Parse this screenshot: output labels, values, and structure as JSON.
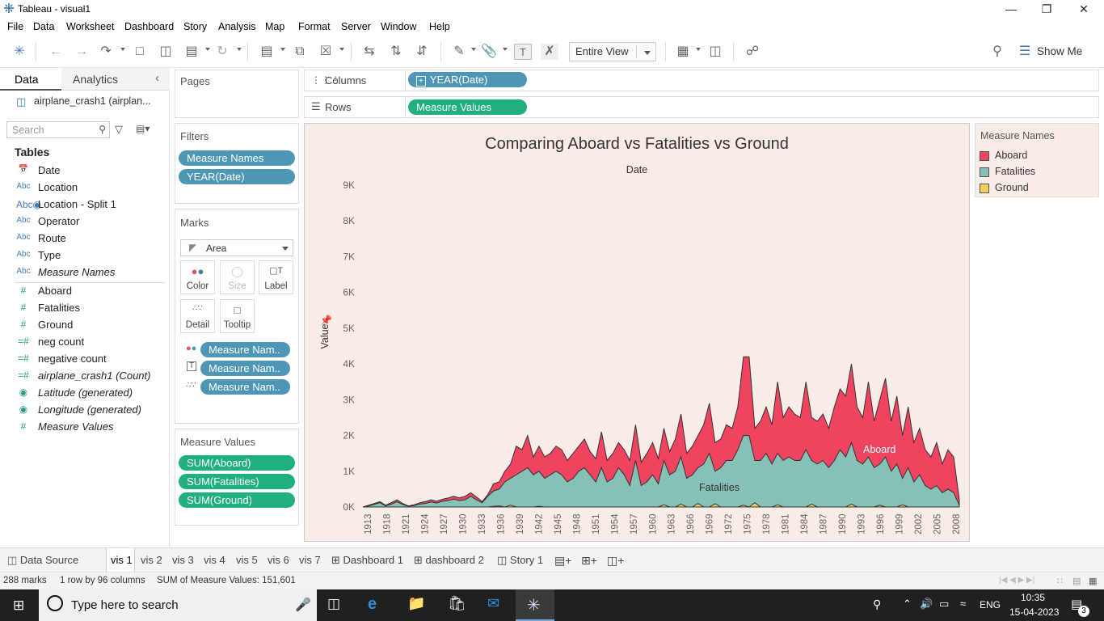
{
  "window": {
    "title": "Tableau - visual1"
  },
  "menu": [
    "File",
    "Data",
    "Worksheet",
    "Dashboard",
    "Story",
    "Analysis",
    "Map",
    "Format",
    "Server",
    "Window",
    "Help"
  ],
  "toolbar": {
    "fit": "Entire View",
    "show_me": "Show Me"
  },
  "datapane": {
    "tab_data": "Data",
    "tab_analytics": "Analytics",
    "datasource": "airplane_crash1 (airplan...",
    "search_placeholder": "Search",
    "tables_heading": "Tables",
    "dimensions": [
      {
        "type": "date",
        "name": "Date"
      },
      {
        "type": "Abc",
        "name": "Location"
      },
      {
        "type": "geo",
        "name": "Location - Split 1"
      },
      {
        "type": "Abc",
        "name": "Operator"
      },
      {
        "type": "Abc",
        "name": "Route"
      },
      {
        "type": "Abc",
        "name": "Type"
      },
      {
        "type": "Abc",
        "name": "Measure Names"
      }
    ],
    "measures": [
      {
        "type": "#",
        "name": "Aboard"
      },
      {
        "type": "#",
        "name": "Fatalities"
      },
      {
        "type": "#",
        "name": "Ground"
      },
      {
        "type": "=#",
        "name": "neg count"
      },
      {
        "type": "=#",
        "name": "negative count"
      },
      {
        "type": "=#",
        "name": "airplane_crash1 (Count)"
      },
      {
        "type": "geo",
        "name": "Latitude (generated)"
      },
      {
        "type": "geo",
        "name": "Longitude (generated)"
      },
      {
        "type": "#",
        "name": "Measure Values"
      }
    ]
  },
  "shelves": {
    "pages": "Pages",
    "filters": "Filters",
    "filter_pills": [
      "Measure Names",
      "YEAR(Date)"
    ],
    "marks": "Marks",
    "mark_type": "Area",
    "mark_buttons": [
      "Color",
      "Size",
      "Label",
      "Detail",
      "Tooltip"
    ],
    "mark_pills": [
      "Measure Nam..",
      "Measure Nam..",
      "Measure Nam.."
    ],
    "measure_values": "Measure Values",
    "measure_value_pills": [
      "SUM(Aboard)",
      "SUM(Fatalities)",
      "SUM(Ground)"
    ],
    "columns_label": "Columns",
    "columns_pill": "YEAR(Date)",
    "rows_label": "Rows",
    "rows_pill": "Measure Values"
  },
  "legend": {
    "title": "Measure Names",
    "items": [
      {
        "name": "Aboard",
        "color": "#f0435f"
      },
      {
        "name": "Fatalities",
        "color": "#86c1b5"
      },
      {
        "name": "Ground",
        "color": "#f4cd5c"
      }
    ]
  },
  "chart_data": {
    "type": "area",
    "title": "Comparing Aboard vs Fatalities vs Ground",
    "xlabel": "Date",
    "ylabel": "Value",
    "ylim": [
      0,
      9000
    ],
    "yticks": [
      "9K",
      "8K",
      "7K",
      "6K",
      "5K",
      "4K",
      "3K",
      "2K",
      "1K",
      "0K"
    ],
    "xtick_labels": [
      "1913",
      "1918",
      "1921",
      "1924",
      "1927",
      "1930",
      "1933",
      "1936",
      "1939",
      "1942",
      "1945",
      "1948",
      "1951",
      "1954",
      "1957",
      "1960",
      "1963",
      "1966",
      "1969",
      "1972",
      "1975",
      "1978",
      "1981",
      "1984",
      "1987",
      "1990",
      "1993",
      "1996",
      "1999",
      "2002",
      "2005",
      "2008"
    ],
    "annotations": [
      "Aboard",
      "Fatalities"
    ],
    "series": [
      {
        "name": "Aboard",
        "values": [
          0,
          50,
          100,
          150,
          50,
          120,
          200,
          100,
          30,
          60,
          120,
          150,
          200,
          160,
          220,
          250,
          300,
          250,
          300,
          400,
          280,
          150,
          350,
          650,
          700,
          1000,
          1200,
          1700,
          1600,
          2000,
          1400,
          1700,
          1400,
          1500,
          1700,
          1600,
          1300,
          1500,
          1700,
          1900,
          1550,
          1350,
          2100,
          1300,
          1500,
          1800,
          1600,
          1300,
          2300,
          1250,
          1500,
          1800,
          1350,
          2200,
          1550,
          1900,
          2600,
          1500,
          1700,
          2000,
          2300,
          2900,
          1800,
          1900,
          2300,
          2200,
          2800,
          4200,
          4200,
          2200,
          2400,
          2800,
          2300,
          3500,
          2500,
          2800,
          2600,
          2500,
          3500,
          2500,
          2400,
          2600,
          2200,
          2800,
          3300,
          3100,
          4000,
          2800,
          2500,
          3500,
          2400,
          3000,
          3600,
          2400,
          3100,
          2000,
          2800,
          1800,
          2200,
          1600,
          1400,
          1800,
          1200,
          1600,
          1400,
          200
        ]
      },
      {
        "name": "Fatalities",
        "values": [
          0,
          30,
          70,
          120,
          30,
          80,
          150,
          70,
          20,
          40,
          80,
          100,
          140,
          110,
          160,
          180,
          220,
          180,
          200,
          300,
          200,
          120,
          300,
          450,
          500,
          700,
          800,
          900,
          1000,
          1100,
          900,
          1000,
          800,
          900,
          1000,
          900,
          700,
          800,
          1000,
          1100,
          900,
          700,
          1100,
          700,
          800,
          1100,
          900,
          600,
          1300,
          600,
          700,
          900,
          650,
          1300,
          900,
          1000,
          1400,
          800,
          900,
          1100,
          1200,
          1500,
          1000,
          1100,
          1300,
          1300,
          1600,
          2000,
          2000,
          1300,
          1300,
          1500,
          1200,
          1500,
          1300,
          1400,
          1300,
          1300,
          1600,
          1300,
          1200,
          1300,
          1100,
          1300,
          1600,
          1400,
          1800,
          1300,
          1200,
          1400,
          1100,
          1200,
          1400,
          1000,
          1200,
          800,
          1100,
          700,
          900,
          600,
          500,
          600,
          400,
          500,
          400,
          50
        ]
      },
      {
        "name": "Ground",
        "values": [
          0,
          0,
          0,
          0,
          0,
          0,
          0,
          0,
          0,
          0,
          0,
          0,
          0,
          0,
          0,
          0,
          0,
          0,
          0,
          0,
          0,
          0,
          0,
          20,
          30,
          0,
          50,
          0,
          0,
          0,
          0,
          20,
          0,
          0,
          0,
          0,
          0,
          0,
          0,
          0,
          0,
          0,
          0,
          0,
          0,
          0,
          0,
          0,
          0,
          0,
          0,
          0,
          0,
          60,
          0,
          0,
          80,
          0,
          0,
          100,
          0,
          0,
          90,
          0,
          0,
          0,
          0,
          50,
          0,
          120,
          0,
          0,
          0,
          60,
          0,
          0,
          0,
          0,
          0,
          80,
          0,
          0,
          0,
          0,
          0,
          0,
          80,
          0,
          0,
          0,
          0,
          50,
          0,
          0,
          0,
          60,
          0,
          0,
          0,
          0,
          0,
          0,
          0,
          0,
          0,
          0
        ]
      }
    ]
  },
  "sheettabs": {
    "datasource": "Data Source",
    "tabs": [
      "vis 1",
      "vis 2",
      "vis 3",
      "vis 4",
      "vis 5",
      "vis 6",
      "vis 7",
      "Dashboard 1",
      "dashboard 2",
      "Story 1"
    ],
    "active": "vis 1"
  },
  "status": {
    "marks": "288 marks",
    "dims": "1 row by 96 columns",
    "sum": "SUM of Measure Values: 151,601"
  },
  "taskbar": {
    "search_placeholder": "Type here to search",
    "lang": "ENG",
    "time": "10:35",
    "date": "15-04-2023",
    "notif_count": "3"
  }
}
